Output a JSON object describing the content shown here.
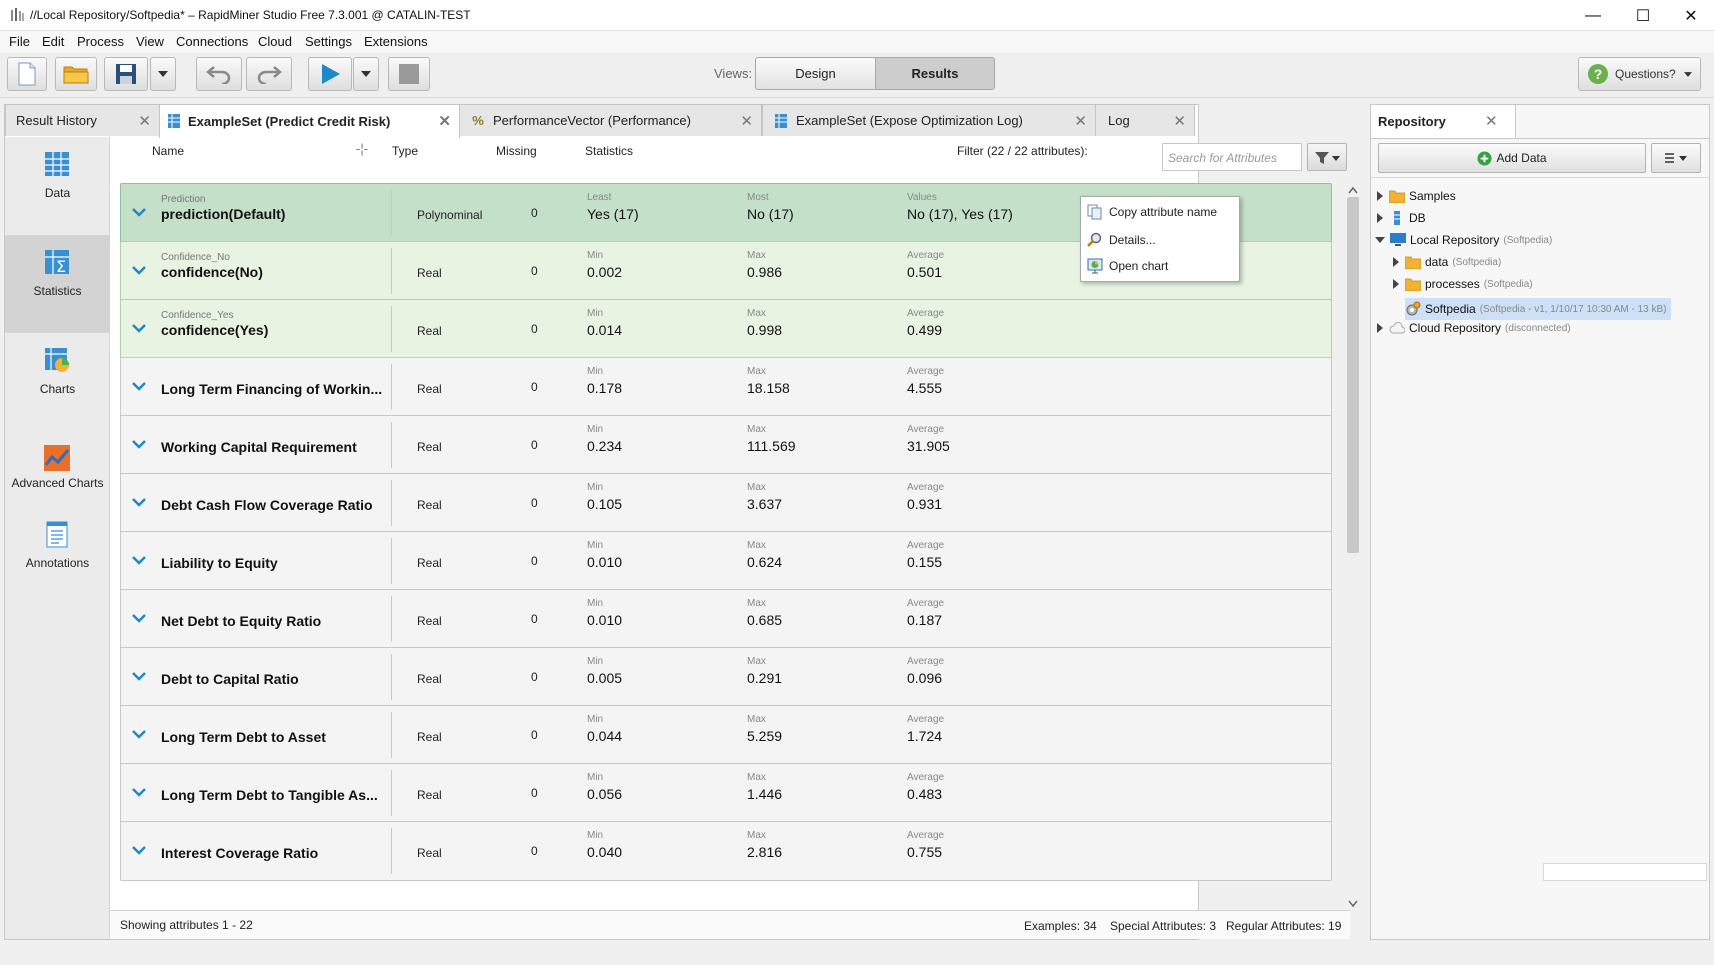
{
  "window": {
    "title": "//Local Repository/Softpedia* – RapidMiner Studio Free 7.3.001 @ CATALIN-TEST"
  },
  "menu": [
    "File",
    "Edit",
    "Process",
    "View",
    "Connections",
    "Cloud",
    "Settings",
    "Extensions"
  ],
  "toolbar": {
    "views_label": "Views:",
    "design_label": "Design",
    "results_label": "Results",
    "questions_label": "Questions?"
  },
  "tabs": [
    {
      "label": "Result History"
    },
    {
      "label": "ExampleSet (Predict Credit Risk)"
    },
    {
      "label": "PerformanceVector (Performance)"
    },
    {
      "label": "ExampleSet (Expose Optimization Log)"
    },
    {
      "label": "Log"
    }
  ],
  "sidenav": [
    {
      "label": "Data"
    },
    {
      "label": "Statistics"
    },
    {
      "label": "Charts"
    },
    {
      "label": "Advanced Charts"
    },
    {
      "label": "Annotations"
    }
  ],
  "header": {
    "name": "Name",
    "type": "Type",
    "missing": "Missing",
    "statistics": "Statistics",
    "filter_label": "Filter (22 / 22 attributes):",
    "search_placeholder": "Search for Attributes"
  },
  "rows": [
    {
      "role": "Prediction",
      "name": "prediction(Default)",
      "type": "Polynominal",
      "missing": "0",
      "s1_label": "Least",
      "s1": "Yes (17)",
      "s2_label": "Most",
      "s2": "No (17)",
      "s3_label": "Values",
      "s3": "No (17), Yes (17)"
    },
    {
      "role": "Confidence_No",
      "name": "confidence(No)",
      "type": "Real",
      "missing": "0",
      "s1_label": "Min",
      "s1": "0.002",
      "s2_label": "Max",
      "s2": "0.986",
      "s3_label": "Average",
      "s3": "0.501"
    },
    {
      "role": "Confidence_Yes",
      "name": "confidence(Yes)",
      "type": "Real",
      "missing": "0",
      "s1_label": "Min",
      "s1": "0.014",
      "s2_label": "Max",
      "s2": "0.998",
      "s3_label": "Average",
      "s3": "0.499"
    },
    {
      "role": "",
      "name": "Long Term Financing of Workin...",
      "type": "Real",
      "missing": "0",
      "s1_label": "Min",
      "s1": "0.178",
      "s2_label": "Max",
      "s2": "18.158",
      "s3_label": "Average",
      "s3": "4.555"
    },
    {
      "role": "",
      "name": "Working Capital Requirement",
      "type": "Real",
      "missing": "0",
      "s1_label": "Min",
      "s1": "0.234",
      "s2_label": "Max",
      "s2": "111.569",
      "s3_label": "Average",
      "s3": "31.905"
    },
    {
      "role": "",
      "name": "Debt Cash Flow Coverage Ratio",
      "type": "Real",
      "missing": "0",
      "s1_label": "Min",
      "s1": "0.105",
      "s2_label": "Max",
      "s2": "3.637",
      "s3_label": "Average",
      "s3": "0.931"
    },
    {
      "role": "",
      "name": "Liability to Equity",
      "type": "Real",
      "missing": "0",
      "s1_label": "Min",
      "s1": "0.010",
      "s2_label": "Max",
      "s2": "0.624",
      "s3_label": "Average",
      "s3": "0.155"
    },
    {
      "role": "",
      "name": "Net Debt to Equity Ratio",
      "type": "Real",
      "missing": "0",
      "s1_label": "Min",
      "s1": "0.010",
      "s2_label": "Max",
      "s2": "0.685",
      "s3_label": "Average",
      "s3": "0.187"
    },
    {
      "role": "",
      "name": "Debt to Capital Ratio",
      "type": "Real",
      "missing": "0",
      "s1_label": "Min",
      "s1": "0.005",
      "s2_label": "Max",
      "s2": "0.291",
      "s3_label": "Average",
      "s3": "0.096"
    },
    {
      "role": "",
      "name": "Long Term Debt to Asset",
      "type": "Real",
      "missing": "0",
      "s1_label": "Min",
      "s1": "0.044",
      "s2_label": "Max",
      "s2": "5.259",
      "s3_label": "Average",
      "s3": "1.724"
    },
    {
      "role": "",
      "name": "Long Term Debt to Tangible As...",
      "type": "Real",
      "missing": "0",
      "s1_label": "Min",
      "s1": "0.056",
      "s2_label": "Max",
      "s2": "1.446",
      "s3_label": "Average",
      "s3": "0.483"
    },
    {
      "role": "",
      "name": "Interest Coverage Ratio",
      "type": "Real",
      "missing": "0",
      "s1_label": "Min",
      "s1": "0.040",
      "s2_label": "Max",
      "s2": "2.816",
      "s3_label": "Average",
      "s3": "0.755"
    }
  ],
  "context_menu": [
    "Copy attribute name",
    "Details...",
    "Open chart"
  ],
  "status": {
    "showing": "Showing attributes 1 - 22",
    "examples": "Examples: 34",
    "special": "Special Attributes: 3",
    "regular": "Regular Attributes: 19"
  },
  "repository": {
    "title": "Repository",
    "add_data": "Add Data",
    "nodes": [
      {
        "label": "Samples",
        "meta": ""
      },
      {
        "label": "DB",
        "meta": ""
      },
      {
        "label": "Local Repository",
        "meta": "(Softpedia)"
      },
      {
        "label": "data",
        "meta": "(Softpedia)"
      },
      {
        "label": "processes",
        "meta": "(Softpedia)"
      },
      {
        "label": "Softpedia",
        "meta": "(Softpedia - v1, 1/10/17 10:30 AM - 13 kB)"
      },
      {
        "label": "Cloud Repository",
        "meta": "(disconnected)"
      }
    ]
  },
  "colors": {
    "accent": "#1e88c8",
    "special_row": "#e8f3e2",
    "selected_row": "#c5e0c8"
  }
}
